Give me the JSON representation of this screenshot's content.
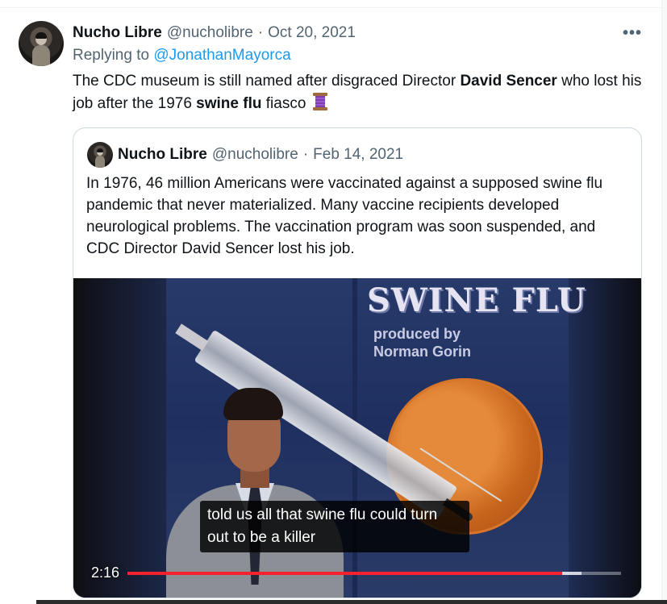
{
  "tweet": {
    "author_name": "Nucho Libre",
    "author_handle": "@nucholibre",
    "separator": "·",
    "date": "Oct 20, 2021",
    "more_icon": "more-horizontal-icon",
    "more_label": "•••",
    "replying_prefix": "Replying to",
    "replying_to": "@JonathanMayorca",
    "text_parts": {
      "p1": "The CDC museum is still named after disgraced Director ",
      "b1": "David Sencer",
      "p2": " who lost his job after the 1976 ",
      "b2": "swine flu",
      "p3": " fiasco"
    },
    "emoji": "spool-of-thread"
  },
  "quoted_tweet": {
    "author_name": "Nucho Libre",
    "author_handle": "@nucholibre",
    "separator": "·",
    "date": "Feb 14, 2021",
    "text": "In 1976, 46 million Americans were vaccinated against a supposed swine flu pandemic that never materialized. Many vaccine recipients developed neurological problems. The vaccination program was soon suspended, and CDC Director David Sencer lost his job."
  },
  "video": {
    "title_art": "SWINE FLU",
    "credit_line1": "produced by",
    "credit_line2": "Norman Gorin",
    "caption_line1": "told us all that swine flu could turn",
    "caption_line2": "out to be a killer",
    "time_remaining": "2:16",
    "progress_fraction": 0.88,
    "buffered_fraction": 0.92,
    "progress_color": "#f4212e"
  },
  "colors": {
    "text_primary": "#0f1419",
    "text_secondary": "#536471",
    "link": "#1d9bf0",
    "border": "#cfd9de"
  }
}
